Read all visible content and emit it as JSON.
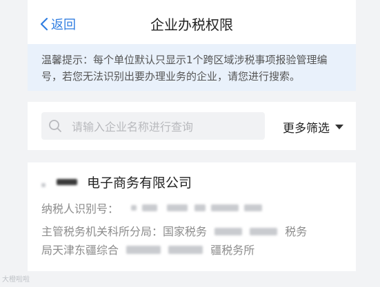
{
  "header": {
    "back_label": "返回",
    "title": "企业办税权限"
  },
  "notice": {
    "line1": "温馨提示：每个单位默认只显示1个跨区域涉税事项报验管理编",
    "line2": "号，若您无法识别出要办理业务的企业，请您进行搜索。"
  },
  "search": {
    "placeholder": "请输入企业名称进行查询",
    "filter_label": "更多筛选"
  },
  "result": {
    "company_suffix": "电子商务有限公司",
    "taxpayer_id_label": "纳税人识别号：",
    "authority_line1_prefix": "主管税务机关科所分局：国家税务",
    "authority_line1_suffix": "税务",
    "authority_line2_prefix": "局天津东疆综合",
    "authority_line2_suffix": "疆税务所"
  },
  "watermark": "大橙啦啦"
}
